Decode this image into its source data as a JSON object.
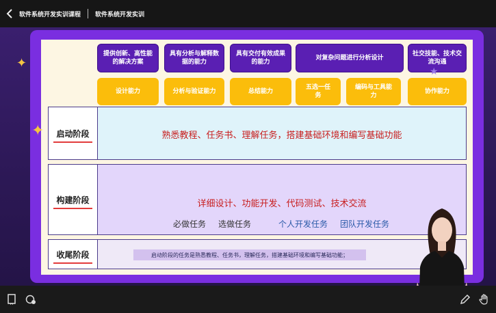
{
  "header": {
    "course_title": "软件系统开发实训课程",
    "page_title": "软件系统开发实训"
  },
  "slide": {
    "capabilities": [
      {
        "label": "提供创新、高性能的解决方案"
      },
      {
        "label": "具有分析与解释数据的能力"
      },
      {
        "label": "具有交付有效成果的能力"
      },
      {
        "label": "对复杂问题进行分析设计"
      },
      {
        "label": "社交技能、技术交流沟通"
      }
    ],
    "skills": [
      {
        "label": "设计能力"
      },
      {
        "label": "分析与验证能力"
      },
      {
        "label": "总结能力"
      },
      {
        "label": "五选一任务"
      },
      {
        "label": "编码与工具能力"
      },
      {
        "label": "协作能力"
      }
    ],
    "stages": {
      "launch": {
        "label": "启动阶段",
        "content": "熟悉教程、任务书、理解任务，搭建基础环境和编写基础功能"
      },
      "build": {
        "label": "构建阶段",
        "content": "详细设计、功能开发、代码测试、技术交流",
        "tags": [
          "必做任务",
          "选做任务",
          "个人开发任务",
          "团队开发任务"
        ]
      },
      "close": {
        "label": "收尾阶段"
      }
    }
  },
  "caption": {
    "text": "启动阶段的任务是熟悉教程、任务书，理解任务，搭建基础环境和编写基础功能；"
  },
  "icons": [
    "back-icon",
    "notes-icon",
    "record-icon",
    "pen-icon",
    "hand-icon"
  ],
  "colors": {
    "slide_frame": "#7a2ee0",
    "capability_purple": "#5a1fb3",
    "skill_yellow": "#fbbd0b",
    "launch_bg": "#dff3fa",
    "build_bg": "#e3d6fb",
    "highlight_red": "#c81e1e"
  }
}
